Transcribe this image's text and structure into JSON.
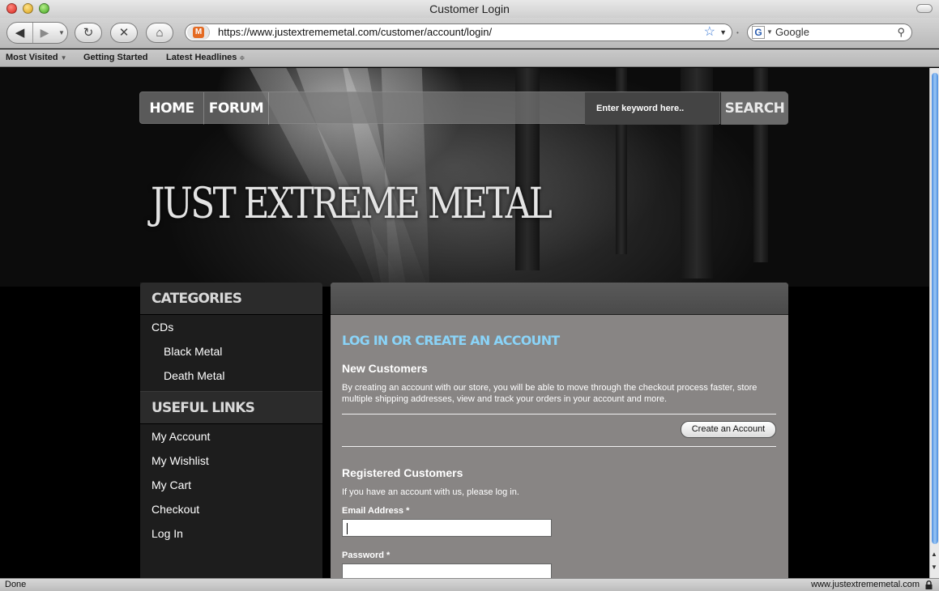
{
  "window": {
    "title": "Customer Login"
  },
  "toolbar": {
    "url": "https://www.justextrememetal.com/customer/account/login/",
    "search_placeholder": "Google"
  },
  "bookmarks": [
    {
      "label": "Most Visited"
    },
    {
      "label": "Getting Started"
    },
    {
      "label": "Latest Headlines"
    }
  ],
  "site": {
    "nav": {
      "home": "HOME",
      "forum": "FORUM",
      "search_placeholder": "Enter keyword here..",
      "search_button": "SEARCH"
    },
    "logo": "JUST EXTREME METAL",
    "sidebar": {
      "categories_heading": "CATEGORIES",
      "categories": [
        {
          "label": "CDs"
        },
        {
          "label": "Black Metal"
        },
        {
          "label": "Death Metal"
        }
      ],
      "useful_links_heading": "USEFUL LINKS",
      "links": [
        {
          "label": "My Account"
        },
        {
          "label": "My Wishlist"
        },
        {
          "label": "My Cart"
        },
        {
          "label": "Checkout"
        },
        {
          "label": "Log In"
        }
      ]
    },
    "login": {
      "heading": "LOG IN OR CREATE AN ACCOUNT",
      "new_title": "New Customers",
      "new_text": "By creating an account with our store, you will be able to move through the checkout process faster, store multiple shipping addresses, view and track your orders in your account and more.",
      "create_button": "Create an Account",
      "registered_title": "Registered Customers",
      "registered_text": "If you have an account with us, please log in.",
      "email_label": "Email Address *",
      "email_value": "",
      "password_label": "Password *",
      "password_value": ""
    }
  },
  "status": {
    "left": "Done",
    "right": "www.justextrememetal.com"
  }
}
